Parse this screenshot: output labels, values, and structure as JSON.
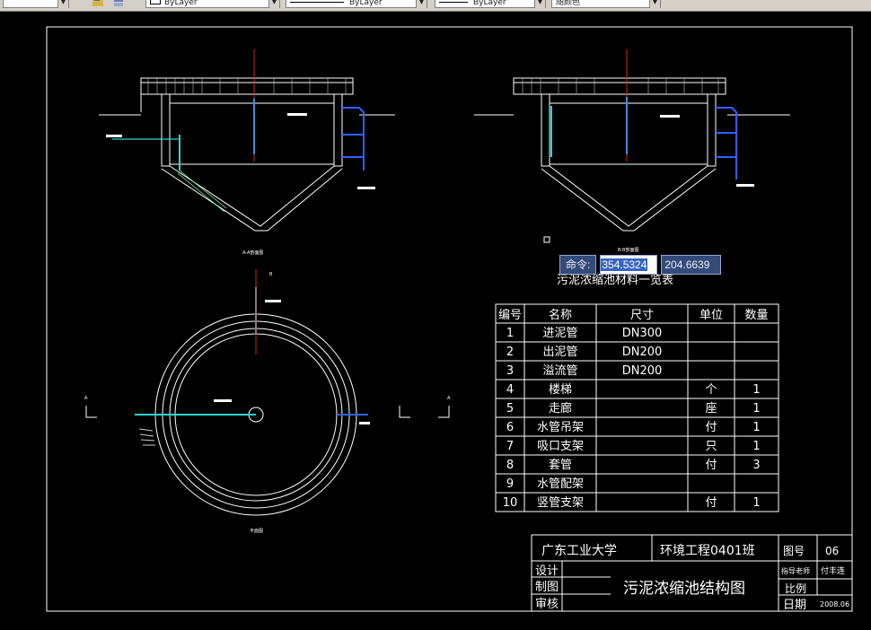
{
  "toolbar": {
    "layer_color": "ByLayer",
    "linetype": "ByLayer",
    "lineweight": "ByLayer",
    "plotstyle": "随颜色"
  },
  "command": {
    "label": "命令:",
    "x": "354.5324",
    "y": "204.6639"
  },
  "drawing": {
    "section_a_title": "A-A剖面图",
    "section_b_title": "B-B剖面图",
    "plan_title": "平面图",
    "cut_a_left": "A",
    "cut_a_right": "A",
    "cut_b_top": "B",
    "cut_b_left": "B",
    "cut_b_right": "B",
    "table_title": "污泥浓缩池材料一览表",
    "table_headers": [
      "编号",
      "名称",
      "尺寸",
      "单位",
      "数量"
    ],
    "table_rows": [
      [
        "1",
        "进泥管",
        "DN300",
        "",
        ""
      ],
      [
        "2",
        "出泥管",
        "DN200",
        "",
        ""
      ],
      [
        "3",
        "溢流管",
        "DN200",
        "",
        ""
      ],
      [
        "4",
        "楼梯",
        "",
        "个",
        "1"
      ],
      [
        "5",
        "走廊",
        "",
        "座",
        "1"
      ],
      [
        "6",
        "水管吊架",
        "",
        "付",
        "1"
      ],
      [
        "7",
        "吸口支架",
        "",
        "只",
        "1"
      ],
      [
        "8",
        "套管",
        "",
        "付",
        "3"
      ],
      [
        "9",
        "水管配架",
        "",
        "",
        ""
      ],
      [
        "10",
        "竖管支架",
        "",
        "付",
        "1"
      ]
    ],
    "title_block": {
      "school": "广东工业大学",
      "class": "环境工程0401班",
      "drawing_no_label": "图号",
      "drawing_no": "06",
      "design": "设计",
      "drafting": "制图",
      "review": "审核",
      "name": "污泥浓缩池结构图",
      "instructor_label": "指导老师",
      "instructor": "付丰连",
      "scale": "比例",
      "date_label": "日期",
      "date": "2008.06"
    }
  }
}
